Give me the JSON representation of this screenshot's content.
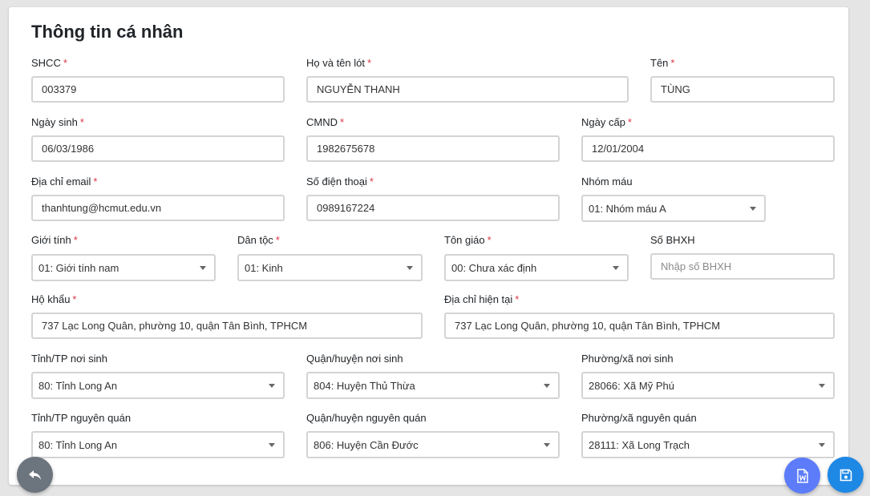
{
  "title": "Thông tin cá nhân",
  "required_mark": "*",
  "fields": {
    "shcc": {
      "label": "SHCC",
      "value": "003379"
    },
    "ho_ten_lot": {
      "label": "Họ và tên lót",
      "value": "NGUYỄN THANH"
    },
    "ten": {
      "label": "Tên",
      "value": "TÙNG"
    },
    "ngay_sinh": {
      "label": "Ngày sinh",
      "value": "06/03/1986"
    },
    "cmnd": {
      "label": "CMND",
      "value": "1982675678"
    },
    "ngay_cap": {
      "label": "Ngày cấp",
      "value": "12/01/2004"
    },
    "email": {
      "label": "Địa chỉ email",
      "value": "thanhtung@hcmut.edu.vn"
    },
    "sdt": {
      "label": "Số điện thoại",
      "value": "0989167224"
    },
    "nhom_mau": {
      "label": "Nhóm máu",
      "value": "01: Nhóm máu A"
    },
    "gioi_tinh": {
      "label": "Giới tính",
      "value": "01: Giới tính nam"
    },
    "dan_toc": {
      "label": "Dân tộc",
      "value": "01: Kinh"
    },
    "ton_giao": {
      "label": "Tôn giáo",
      "value": "00: Chưa xác định"
    },
    "so_bhxh": {
      "label": "Số BHXH",
      "value": "",
      "placeholder": "Nhập số BHXH"
    },
    "ho_khau": {
      "label": "Hộ khẩu",
      "value": "737 Lạc Long Quân, phường 10, quận Tân Bình, TPHCM"
    },
    "dia_chi_hien_tai": {
      "label": "Địa chỉ hiện tại",
      "value": "737 Lạc Long Quân, phường 10, quận Tân Bình, TPHCM"
    },
    "tinh_noi_sinh": {
      "label": "Tỉnh/TP nơi sinh",
      "value": "80: Tỉnh Long An"
    },
    "quan_noi_sinh": {
      "label": "Quận/huyện nơi sinh",
      "value": "804: Huyện Thủ Thừa"
    },
    "phuong_noi_sinh": {
      "label": "Phường/xã nơi sinh",
      "value": "28066: Xã Mỹ Phú"
    },
    "tinh_nguyen_quan": {
      "label": "Tỉnh/TP nguyên quán",
      "value": "80: Tỉnh Long An"
    },
    "quan_nguyen_quan": {
      "label": "Quận/huyện nguyên quán",
      "value": "806: Huyện Cần Đước"
    },
    "phuong_nguyen_quan": {
      "label": "Phường/xã nguyên quán",
      "value": "28111: Xã Long Trạch"
    }
  },
  "buttons": {
    "back": {
      "icon": "undo-arrow-icon"
    },
    "word": {
      "icon": "word-document-icon"
    },
    "save": {
      "icon": "floppy-disk-icon"
    }
  },
  "colors": {
    "required": "#dc3545",
    "back_button": "#6c757d",
    "word_button": "#5c7cfa",
    "save_button": "#1e88e5"
  }
}
